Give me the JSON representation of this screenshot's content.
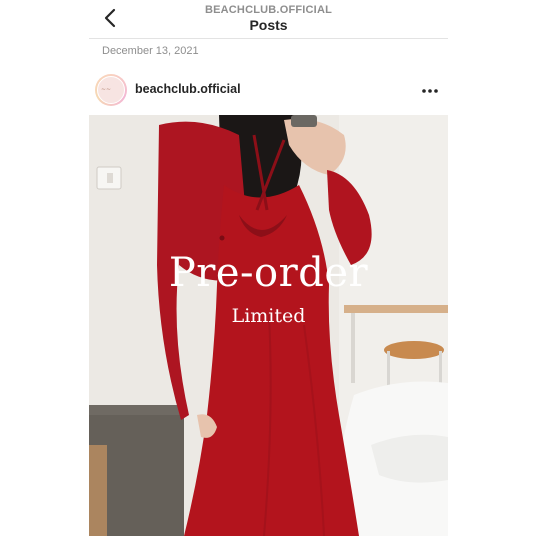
{
  "header": {
    "subtitle": "BEACHCLUB.OFFICIAL",
    "title": "Posts"
  },
  "post": {
    "date": "December 13, 2021",
    "username": "beachclub.official",
    "overlay_title": "Pre-order",
    "overlay_subtitle": "Limited"
  },
  "icons": {
    "back": "chevron-left-icon",
    "more": "more-horizontal-icon"
  },
  "colors": {
    "dress": "#b3141d",
    "text": "#262626",
    "muted": "#8e8e8e"
  }
}
